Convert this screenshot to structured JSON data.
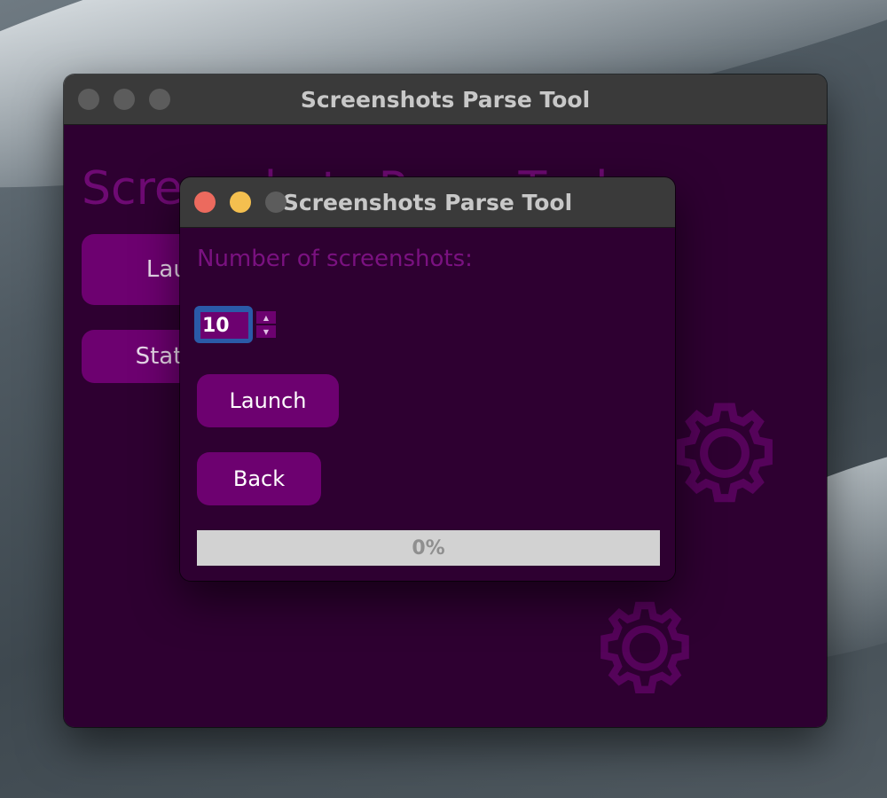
{
  "main_window": {
    "title": "Screenshots Parse Tool",
    "heading": "Screenshots Parse Tool",
    "launch_label": "Launch",
    "stats_label": "Statistics"
  },
  "dialog": {
    "title": "Screenshots Parse Tool",
    "label": "Number of screenshots:",
    "spinbox_value": "10",
    "launch_label": "Launch",
    "back_label": "Back",
    "progress": {
      "value": 0,
      "text": "0%"
    }
  },
  "colors": {
    "content_bg": "#2e0031",
    "button_bg": "#6d0170",
    "accent_purple": "#7a1180",
    "focus_blue": "#2a5aa8",
    "close_red": "#ec6a5e",
    "minimize_yellow": "#f4bf4f"
  },
  "icons": [
    "gear-icon",
    "gear-icon"
  ]
}
